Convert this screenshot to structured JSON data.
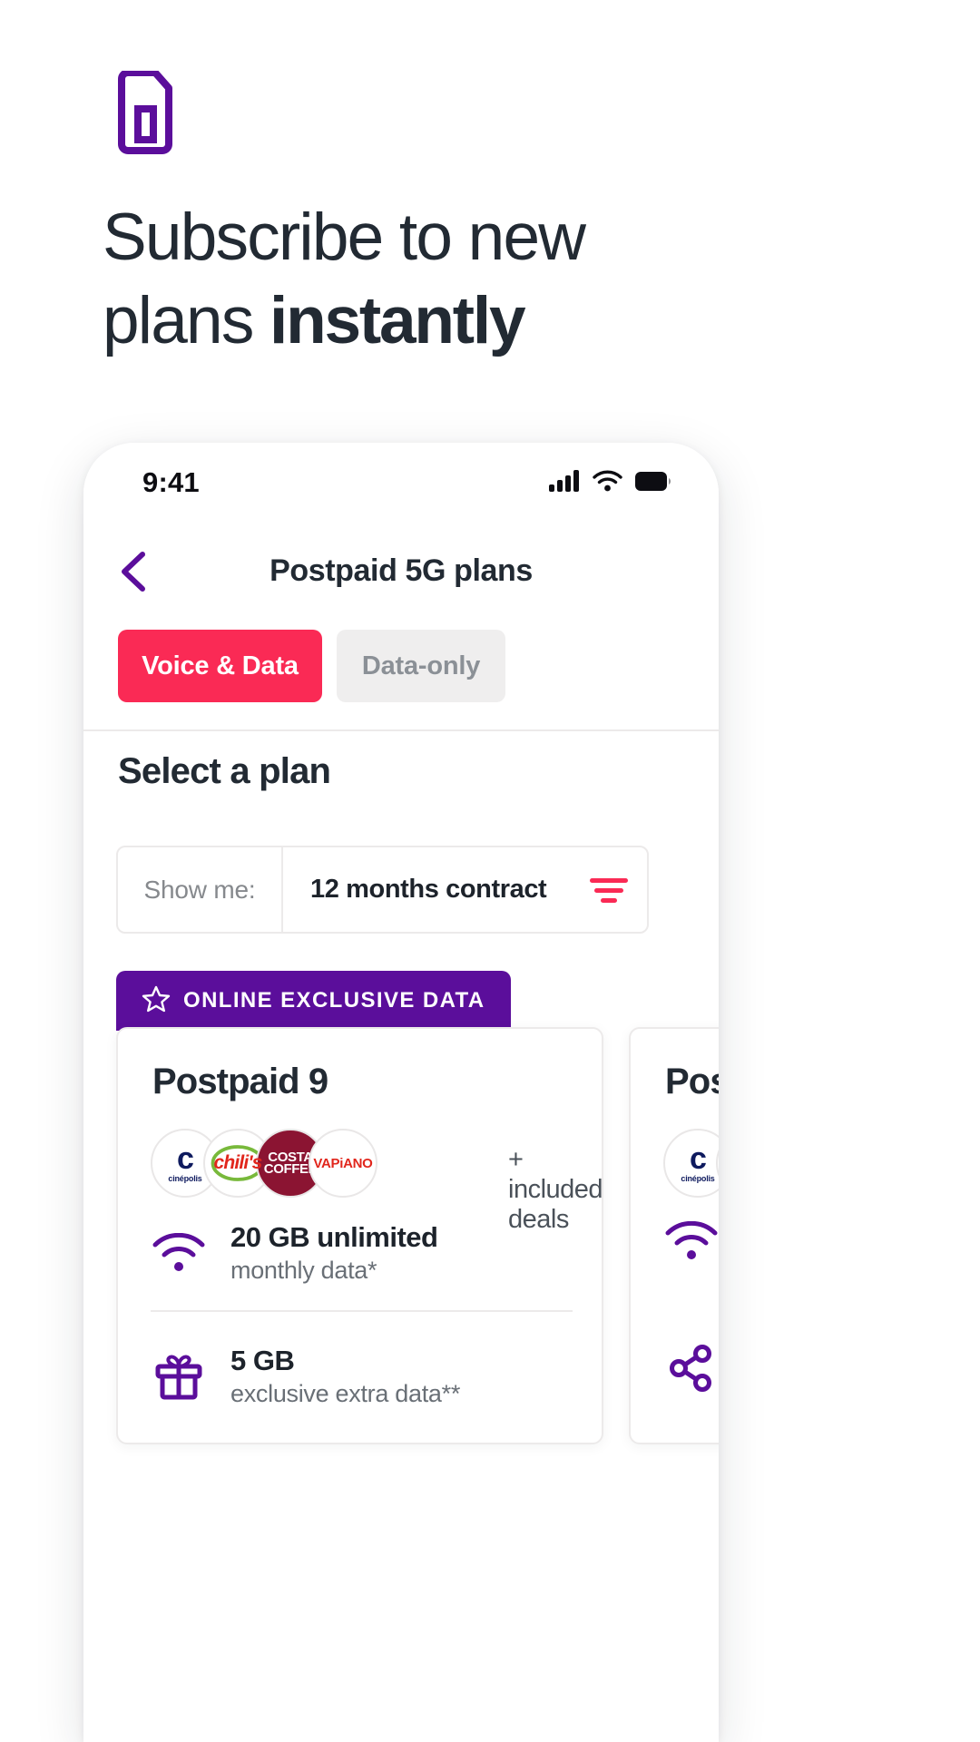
{
  "hero": {
    "icon": "sim-card-icon",
    "headline_part1": "Subscribe to new plans ",
    "headline_strong": "instantly",
    "icon_color": "#5b0e9b",
    "text_color": "#222a33"
  },
  "phone": {
    "status": {
      "time": "9:41",
      "signal_icon": "cellular-signal-icon",
      "wifi_icon": "wifi-icon",
      "battery_icon": "battery-full-icon"
    },
    "header": {
      "back_icon": "chevron-left-icon",
      "title": "Postpaid 5G plans"
    },
    "tabs": [
      {
        "label": "Voice & Data",
        "active": true,
        "bg": "#fa2a55",
        "fg": "#ffffff"
      },
      {
        "label": "Data-only",
        "active": false,
        "bg": "#efeeee",
        "fg": "#8b9096"
      }
    ],
    "section_title": "Select a plan",
    "filter": {
      "label": "Show me:",
      "value": "12 months contract",
      "icon": "filter-icon",
      "icon_color": "#fa2a55"
    },
    "badge": {
      "icon": "star-icon",
      "label": "ONLINE EXCLUSIVE DATA",
      "bg": "#5b0e9b"
    },
    "cards": [
      {
        "title": "Postpaid 9",
        "deals_text": "+ included deals",
        "logos": [
          {
            "name": "cinepolis-logo",
            "mark": "c",
            "caption": "cinépolis",
            "color": "#0e1a5e"
          },
          {
            "name": "chilis-logo",
            "mark": "chili's",
            "color": "#e1261c"
          },
          {
            "name": "costa-coffee-logo",
            "mark": "COSTA",
            "sub": "COFFEE",
            "color": "#8b1432"
          },
          {
            "name": "vapiano-logo",
            "mark": "VAPiANO",
            "color": "#e1261c"
          }
        ],
        "features": [
          {
            "icon": "wifi-icon",
            "title": "20 GB unlimited",
            "sub": "monthly data*"
          },
          {
            "icon": "gift-icon",
            "title": "5 GB",
            "sub": "exclusive extra data**"
          }
        ]
      },
      {
        "title": "Pos",
        "logos": [
          {
            "name": "cinepolis-logo",
            "mark": "c",
            "caption": "cinépolis",
            "color": "#0e1a5e"
          }
        ],
        "features": [
          {
            "icon": "wifi-icon",
            "title": "",
            "sub": ""
          },
          {
            "icon": "share-icon",
            "title": "",
            "sub": ""
          }
        ]
      }
    ]
  }
}
